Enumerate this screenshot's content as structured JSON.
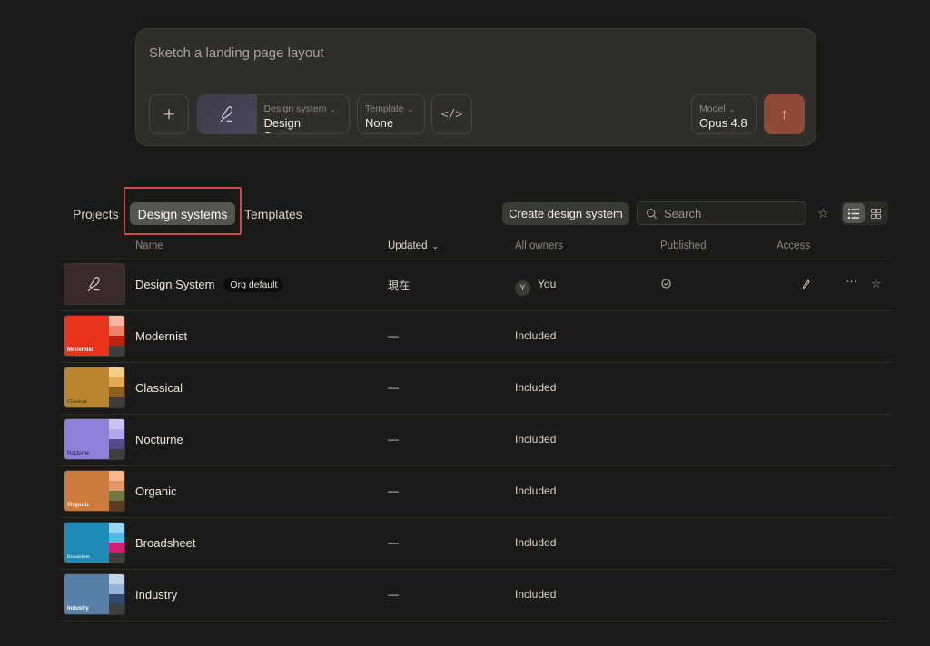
{
  "composer": {
    "prompt_placeholder": "Sketch a landing page layout",
    "design_system": {
      "label": "Design system",
      "value": "Design System"
    },
    "template": {
      "label": "Template",
      "value": "None"
    },
    "model": {
      "label": "Model",
      "value": "Opus 4.8"
    }
  },
  "tabs": {
    "projects": "Projects",
    "design_systems": "Design systems",
    "templates": "Templates",
    "active": "Design systems"
  },
  "toolbar": {
    "create_label": "Create design system",
    "search_placeholder": "Search"
  },
  "columns": {
    "name": "Name",
    "updated": "Updated",
    "owners": "All owners",
    "published": "Published",
    "access": "Access"
  },
  "rows": [
    {
      "name": "Design System",
      "badge": "Org default",
      "updated": "現在",
      "owner": "You",
      "owner_initial": "Y",
      "published": true,
      "thumb": "pen"
    },
    {
      "name": "Modernist",
      "updated": "—",
      "owner": "Included",
      "thumb_label": "Modernist",
      "colors": [
        "#e8321a",
        "#f4b7a6",
        "#f0826a",
        "#b9220f",
        "#403f3d"
      ]
    },
    {
      "name": "Classical",
      "updated": "—",
      "owner": "Included",
      "thumb_label": "Classical",
      "colors": [
        "#b8842f",
        "#f3cd85",
        "#e2ab53",
        "#8c6022",
        "#403f3d"
      ]
    },
    {
      "name": "Nocturne",
      "updated": "—",
      "owner": "Included",
      "thumb_label": "Nocturne",
      "colors": [
        "#8f7fd9",
        "#cdc3f3",
        "#b3a6ec",
        "#564a8b",
        "#403f3d"
      ]
    },
    {
      "name": "Organic",
      "updated": "—",
      "owner": "Included",
      "thumb_label": "Organic",
      "colors": [
        "#cd7a3d",
        "#f5b98a",
        "#e09764",
        "#6f7a43",
        "#5c3a24"
      ]
    },
    {
      "name": "Broadsheet",
      "updated": "—",
      "owner": "Included",
      "thumb_label": "Broadsheet",
      "colors": [
        "#1d89b5",
        "#9ad6ef",
        "#57b7e0",
        "#d81b74",
        "#403f3d"
      ]
    },
    {
      "name": "Industry",
      "updated": "—",
      "owner": "Included",
      "thumb_label": "Industry",
      "colors": [
        "#5780a8",
        "#c1d4ea",
        "#93b2d6",
        "#2f4a6a",
        "#403f3d"
      ]
    }
  ]
}
